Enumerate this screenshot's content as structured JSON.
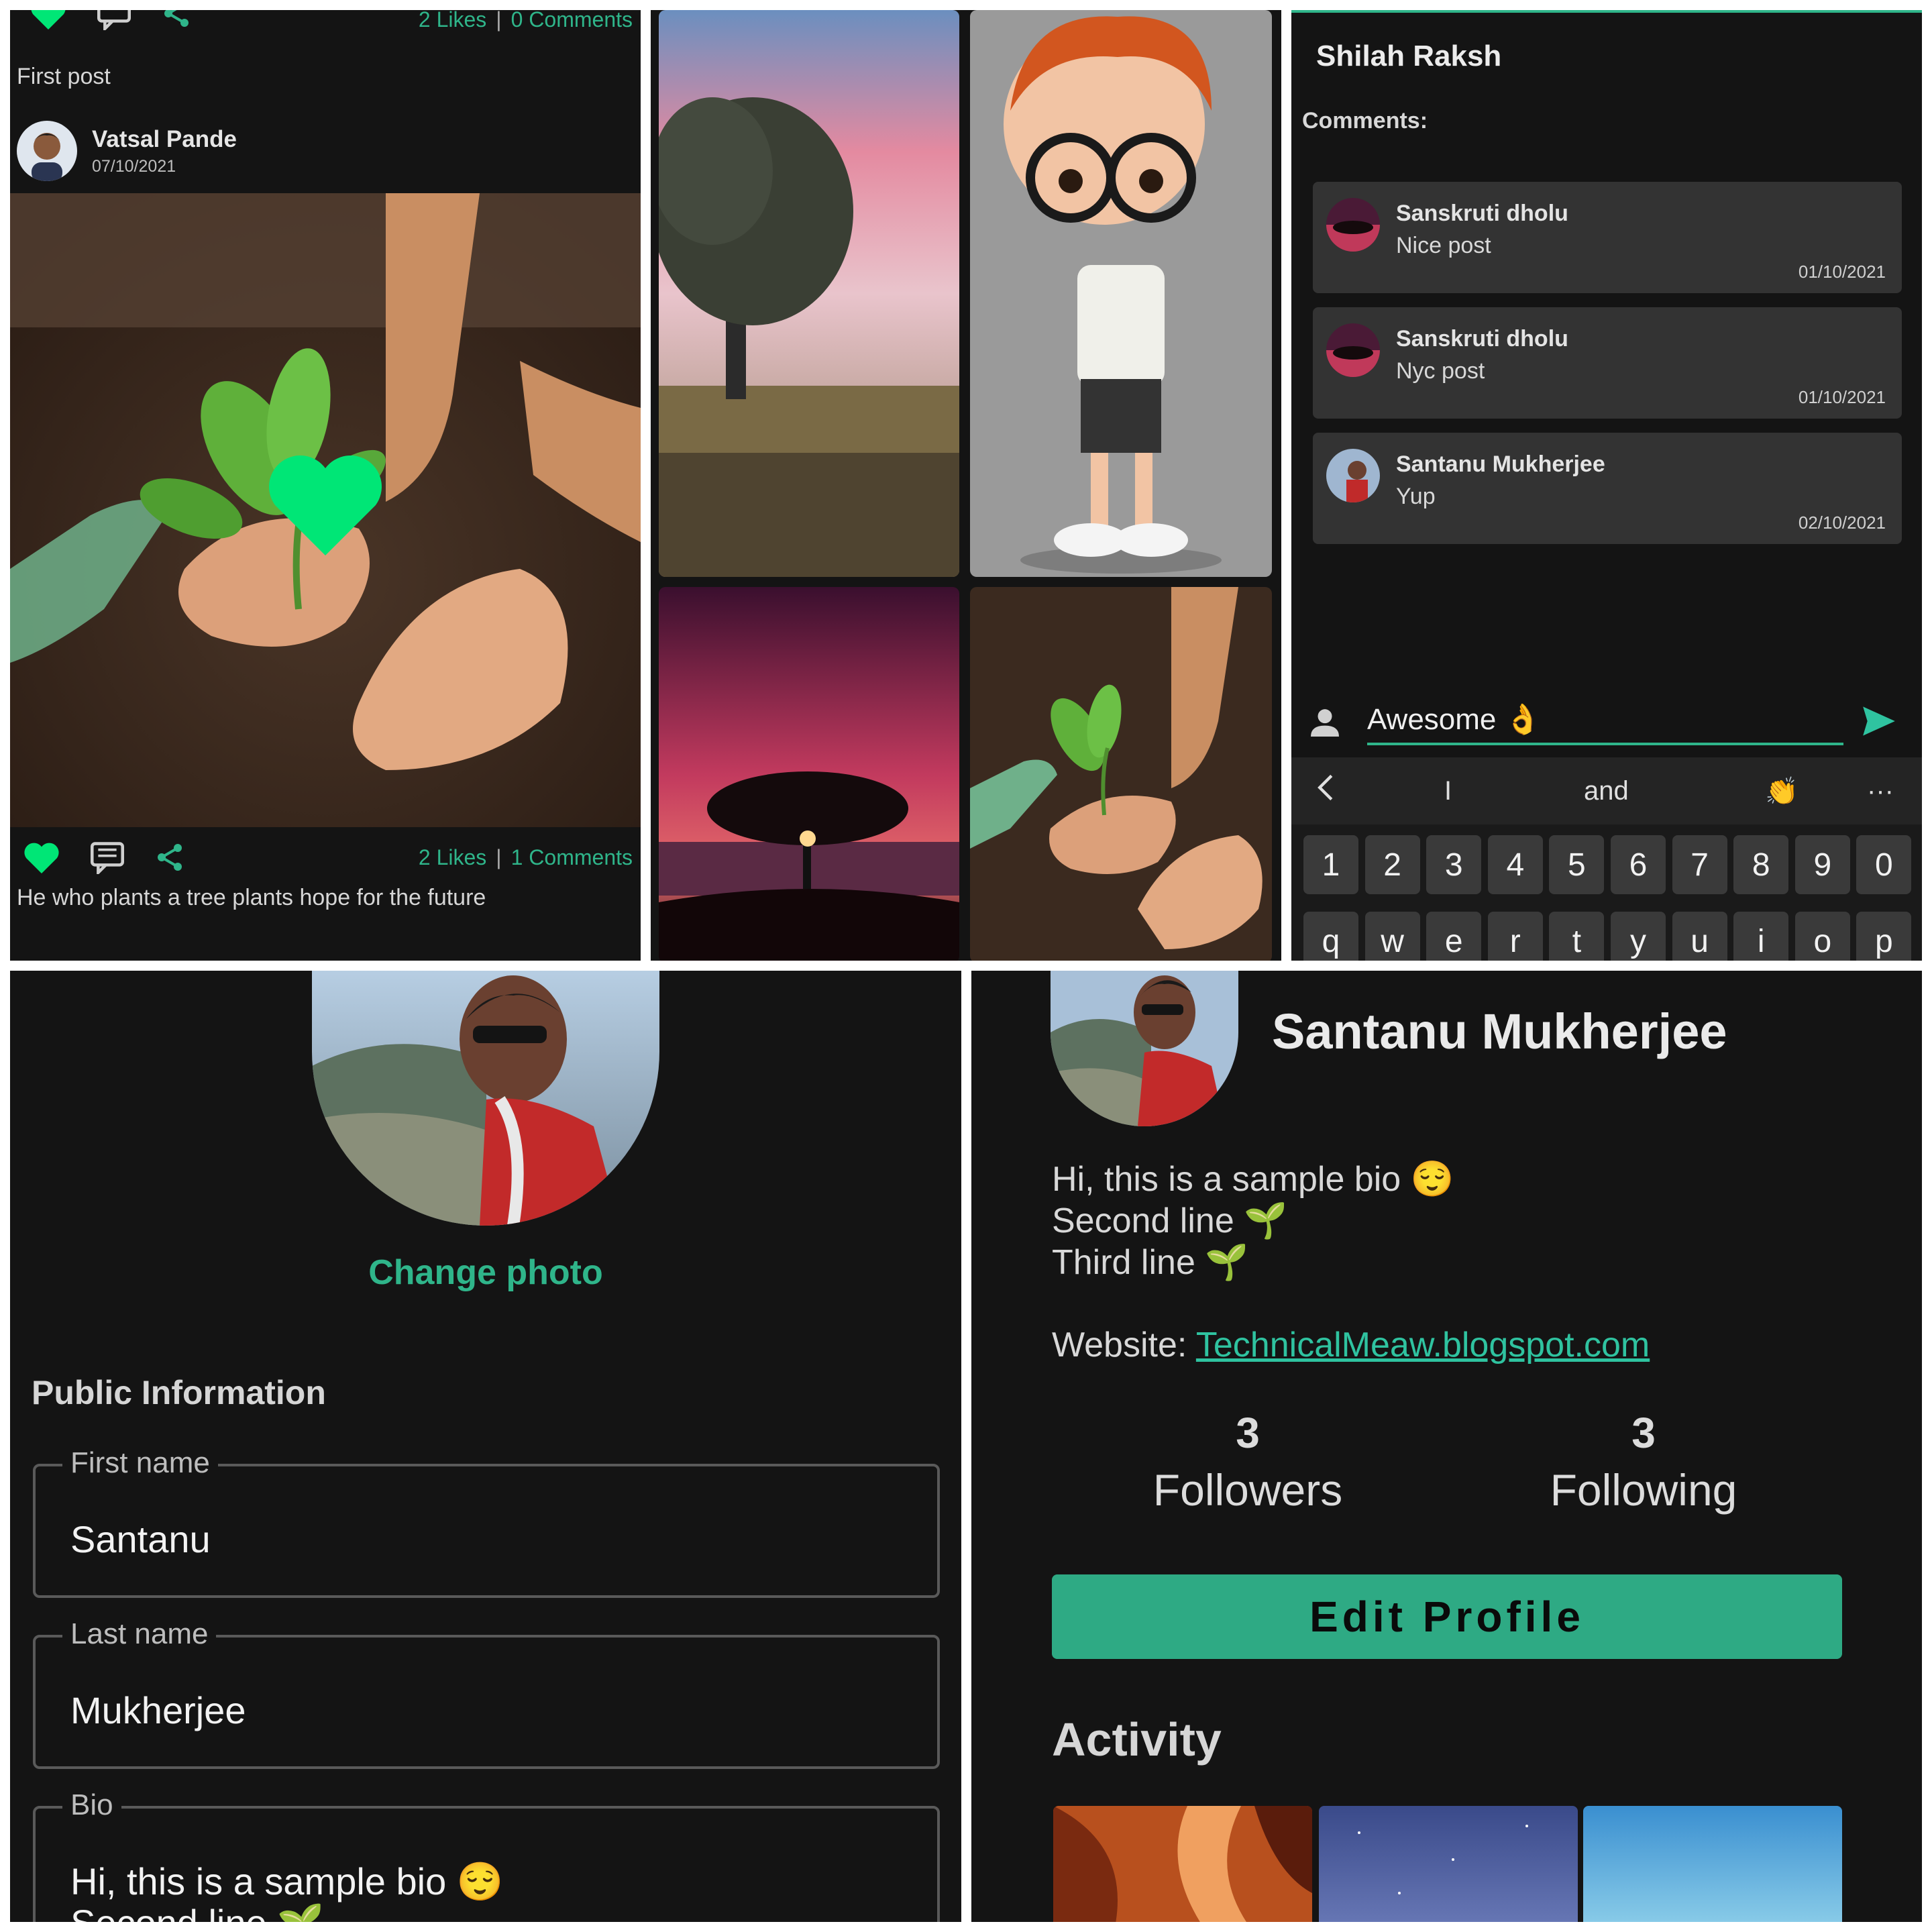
{
  "feed": {
    "top_likes": "2 Likes",
    "top_comments": "0 Comments",
    "separator": "|",
    "first_caption": "First post",
    "author_name": "Vatsal Pande",
    "author_date": "07/10/2021",
    "bottom_likes": "2 Likes",
    "bottom_comments": "1 Comments",
    "bottom_caption": "He who plants a tree plants hope for the future",
    "heart_color": "#00e676",
    "icons": [
      "heart-icon",
      "comment-icon",
      "share-icon"
    ]
  },
  "comments": {
    "title": "Shilah Raksh",
    "label": "Comments:",
    "items": [
      {
        "name": "Sanskruti dholu",
        "text": "Nice post",
        "date": "01/10/2021"
      },
      {
        "name": "Sanskruti dholu",
        "text": "Nyc post",
        "date": "01/10/2021"
      },
      {
        "name": "Santanu Mukherjee",
        "text": "Yup",
        "date": "02/10/2021"
      }
    ],
    "input_value": "Awesome 👌",
    "suggestions": [
      "I",
      "and",
      "👏",
      "···"
    ],
    "number_keys": [
      "1",
      "2",
      "3",
      "4",
      "5",
      "6",
      "7",
      "8",
      "9",
      "0"
    ],
    "letter_keys": [
      "q",
      "w",
      "e",
      "r",
      "t",
      "y",
      "u",
      "i",
      "o",
      "p"
    ]
  },
  "edit_profile": {
    "change_photo": "Change photo",
    "section_title": "Public Information",
    "first_name_label": "First name",
    "first_name_value": "Santanu",
    "last_name_label": "Last name",
    "last_name_value": "Mukherjee",
    "bio_label": "Bio",
    "bio_line1": "Hi, this is a sample bio 😌",
    "bio_line2": "Second line 🌱"
  },
  "profile": {
    "name": "Santanu Mukherjee",
    "bio_lines": [
      "Hi, this is a sample bio 😌",
      "Second line 🌱",
      "Third line 🌱"
    ],
    "website_label": "Website:",
    "website_link": "TechnicalMeaw.blogspot.com",
    "followers_count": "3",
    "followers_label": "Followers",
    "following_count": "3",
    "following_label": "Following",
    "edit_button": "Edit Profile",
    "activity_title": "Activity",
    "accent_color": "#2eaa84"
  }
}
